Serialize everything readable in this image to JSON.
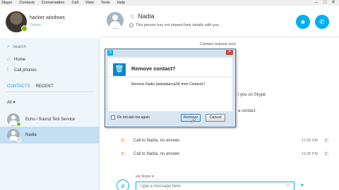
{
  "menu": [
    "Skype",
    "Contacts",
    "Conversation",
    "Call",
    "View",
    "Tools",
    "Help"
  ],
  "window_controls": [
    "–",
    "□",
    "✕"
  ],
  "profile": {
    "name": "hacker windows",
    "status": "Online"
  },
  "search": {
    "placeholder": "Search"
  },
  "nav": {
    "home": "Home",
    "call_phones": "Call phones"
  },
  "tabs": {
    "contacts": "CONTACTS",
    "recent": "RECENT"
  },
  "filter": "All ▾",
  "contacts": [
    {
      "name": "Echo / Sound Test Service"
    },
    {
      "name": "Nadia"
    }
  ],
  "conversation": {
    "name": "Nadia",
    "subtitle": "This person has not shared their details with you.",
    "request_sent": "Contact request sent",
    "partial_1": "l you on Skype",
    "partial_2": "a contact.",
    "calls": [
      {
        "text": "Call to Nadia, no answer.",
        "time": "11:05 PM"
      },
      {
        "text": "Call to Nadia, no answer.",
        "time": "11:05 PM"
      }
    ],
    "via": "via Skype ▾",
    "message_placeholder": "Type a message here"
  },
  "dialog": {
    "heading": "Remove contact?",
    "message": "Remove Nadia (dahiadaeca24) from Contacts?",
    "checkbox": "Do not ask me again",
    "remove": "Remove",
    "cancel": "Cancel"
  },
  "colors": {
    "accent": "#00aff0",
    "online": "#7fba00",
    "missed_call": "#f07830",
    "selected_contact": "#c4def2"
  },
  "icons": [
    "search-icon",
    "home-icon",
    "dialpad-icon",
    "star-icon",
    "info-icon",
    "video-call-icon",
    "call-icon",
    "phone-icon",
    "attach-icon",
    "emoji-icon",
    "send-icon",
    "trash-icon",
    "close-icon",
    "mouse-cursor-icon"
  ]
}
